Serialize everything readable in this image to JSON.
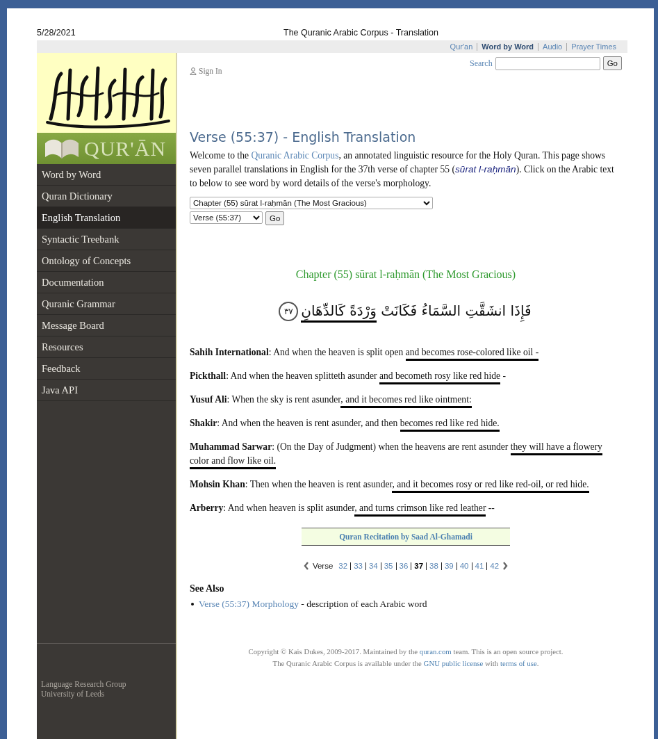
{
  "print_header": {
    "date": "5/28/2021",
    "title": "The Quranic Arabic Corpus - Translation"
  },
  "top_nav": [
    {
      "label": "Qur'an",
      "selected": false
    },
    {
      "label": "Word by Word",
      "selected": true
    },
    {
      "label": "Audio",
      "selected": false
    },
    {
      "label": "Prayer Times",
      "selected": false
    }
  ],
  "sidebar": {
    "logo_text": "QUR'ĀN",
    "items": [
      {
        "label": "Word by Word",
        "selected": false
      },
      {
        "label": "Quran Dictionary",
        "selected": false
      },
      {
        "label": "English Translation",
        "selected": true
      },
      {
        "label": "Syntactic Treebank",
        "selected": false
      },
      {
        "label": "Ontology of Concepts",
        "selected": false
      },
      {
        "label": "Documentation",
        "selected": false
      },
      {
        "label": "Quranic Grammar",
        "selected": false
      },
      {
        "label": "Message Board",
        "selected": false
      },
      {
        "label": "Resources",
        "selected": false
      },
      {
        "label": "Feedback",
        "selected": false
      },
      {
        "label": "Java API",
        "selected": false
      }
    ],
    "footer": [
      "Language Research Group",
      "University of Leeds"
    ]
  },
  "sign_in": "Sign In",
  "search": {
    "label": "Search",
    "button": "Go"
  },
  "heading": "Verse (55:37) - English Translation",
  "intro": [
    {
      "kind": "text",
      "text": "Welcome to the "
    },
    {
      "kind": "link",
      "text": "Quranic Arabic Corpus"
    },
    {
      "kind": "text",
      "text": ", an annotated linguistic resource for the Holy Quran. This page shows seven parallel translations in English for the 37th verse of chapter 55 ("
    },
    {
      "kind": "term",
      "text": "sūrat l-raḥmān"
    },
    {
      "kind": "text",
      "text": "). Click on the Arabic text to below to see word by word details of the verse's morphology."
    }
  ],
  "chapter_select": "Chapter (55) sūrat l-raḥmān (The Most Gracious)",
  "verse_select": "Verse (55:37)",
  "go_button": "Go",
  "chapter_title": "Chapter (55) sūrat l-raḥmān (The Most Gracious)",
  "arabic_verse": {
    "parts": [
      {
        "text": "فَإِذَا انشَقَّتِ السَّمَاءُ فَكَانَتْ ",
        "marked": false
      },
      {
        "text": "وَرْدَةً كَالدِّهَانِ",
        "marked": true
      }
    ],
    "number": "٣٧"
  },
  "translations": [
    {
      "translator": "Sahih International",
      "parts": [
        {
          "text": ": And when the heaven is split open ",
          "marked": false
        },
        {
          "text": "and becomes rose-colored like oil -",
          "marked": true
        }
      ]
    },
    {
      "translator": "Pickthall",
      "parts": [
        {
          "text": ": And when the heaven splitteth asunder ",
          "marked": false
        },
        {
          "text": "and becometh rosy like red hide",
          "marked": true
        },
        {
          "text": " -",
          "marked": false
        }
      ]
    },
    {
      "translator": "Yusuf Ali",
      "parts": [
        {
          "text": ": When the sky is rent asunder",
          "marked": false
        },
        {
          "text": ", and it becomes red like ointment:",
          "marked": true
        }
      ]
    },
    {
      "translator": "Shakir",
      "parts": [
        {
          "text": ": And when the heaven is rent asunder, and then ",
          "marked": false
        },
        {
          "text": "becomes red like red hide.",
          "marked": true
        }
      ]
    },
    {
      "translator": "Muhammad Sarwar",
      "parts": [
        {
          "text": ": (On the Day of Judgment) when the heavens are rent asunder ",
          "marked": false
        },
        {
          "text": "they will have a flowery color and flow like oil.",
          "marked": true
        }
      ]
    },
    {
      "translator": "Mohsin Khan",
      "parts": [
        {
          "text": ": Then when the heaven is rent asunder",
          "marked": false
        },
        {
          "text": ", and it becomes rosy or red like red-oil, or red hide.",
          "marked": true
        }
      ]
    },
    {
      "translator": "Arberry",
      "parts": [
        {
          "text": ": And when heaven is split asunder",
          "marked": false
        },
        {
          "text": ", and turns crimson like red leather",
          "marked": true
        },
        {
          "text": " --",
          "marked": false
        }
      ]
    }
  ],
  "recitation": "Quran Recitation by Saad Al-Ghamadi",
  "pager": {
    "label": "Verse",
    "pages": [
      {
        "label": "32",
        "selected": false
      },
      {
        "label": "33",
        "selected": false
      },
      {
        "label": "34",
        "selected": false
      },
      {
        "label": "35",
        "selected": false
      },
      {
        "label": "36",
        "selected": false
      },
      {
        "label": "37",
        "selected": true
      },
      {
        "label": "38",
        "selected": false
      },
      {
        "label": "39",
        "selected": false
      },
      {
        "label": "40",
        "selected": false
      },
      {
        "label": "41",
        "selected": false
      },
      {
        "label": "42",
        "selected": false
      }
    ]
  },
  "see_also": {
    "title": "See Also",
    "items": [
      {
        "link": "Verse (55:37) Morphology",
        "text": " - description of each Arabic word"
      }
    ]
  },
  "copyright": [
    [
      {
        "kind": "text",
        "text": "Copyright © Kais Dukes, 2009-2017. Maintained by the "
      },
      {
        "kind": "link",
        "text": "quran.com"
      },
      {
        "kind": "text",
        "text": " team. This is an open source project."
      }
    ],
    [
      {
        "kind": "text",
        "text": "The Quranic Arabic Corpus is available under the "
      },
      {
        "kind": "link",
        "text": "GNU public license"
      },
      {
        "kind": "text",
        "text": " with "
      },
      {
        "kind": "link",
        "text": "terms of use"
      },
      {
        "kind": "text",
        "text": "."
      }
    ]
  ]
}
